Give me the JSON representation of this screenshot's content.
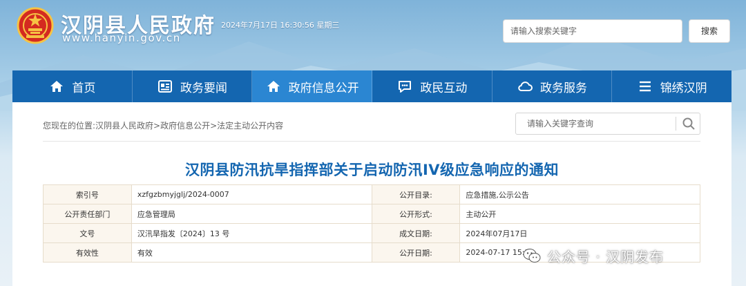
{
  "header": {
    "site_title": "汉阴县人民政府",
    "site_url": "www.hanyin.gov.cn",
    "datetime": "2024年7月17日 16:30:56 星期三",
    "search_placeholder": "请输入搜索关键字",
    "search_button": "搜索"
  },
  "nav": {
    "items": [
      {
        "label": "首页",
        "icon": "home-icon"
      },
      {
        "label": "政务要闻",
        "icon": "news-icon"
      },
      {
        "label": "政府信息公开",
        "icon": "home-icon",
        "active": true
      },
      {
        "label": "政民互动",
        "icon": "chat-icon"
      },
      {
        "label": "政务服务",
        "icon": "cloud-icon"
      },
      {
        "label": "锦绣汉阴",
        "icon": "menu-icon"
      }
    ]
  },
  "content": {
    "breadcrumb": "您现在的位置:汉阴县人民政府>政府信息公开>法定主动公开内容",
    "search_placeholder": "请输入关键字查询",
    "doc_title": "汉阴县防汛抗旱指挥部关于启动防汛IV级应急响应的通知",
    "meta": [
      {
        "k1": "索引号",
        "v1": "xzfgzbmyjglj/2024-0007",
        "k2": "公开目录:",
        "v2": "应急措施,公示公告"
      },
      {
        "k1": "公开责任部门",
        "v1": "应急管理局",
        "k2": "公开形式:",
        "v2": "主动公开"
      },
      {
        "k1": "文号",
        "v1": "汉汛旱指发〔2024〕13 号",
        "k2": "成文日期:",
        "v2": "2024年07月17日"
      },
      {
        "k1": "有效性",
        "v1": "有效",
        "k2": "公开日期:",
        "v2": "2024-07-17 15:31"
      }
    ]
  },
  "watermark": {
    "text": "公众号 · 汉阴发布"
  },
  "colors": {
    "nav_bg": "#1466b0",
    "nav_active": "#2b86d2",
    "title": "#1466b0",
    "table_key_bg": "#fbf6ee"
  }
}
